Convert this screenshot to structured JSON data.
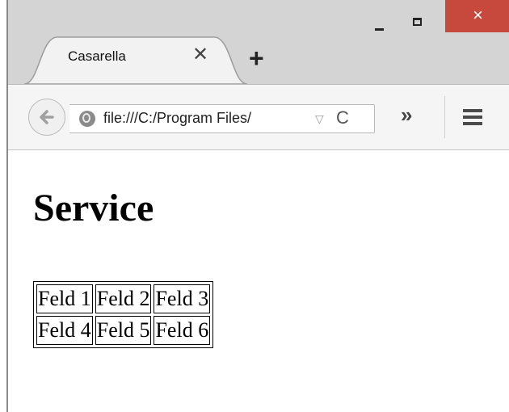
{
  "window": {
    "controls": {
      "close_glyph": "×"
    }
  },
  "tabs": [
    {
      "title": "Casarella",
      "close_glyph": "✕"
    }
  ],
  "new_tab_glyph": "+",
  "toolbar": {
    "back_glyph": "🡐",
    "url": "file:///C:/Program Files/",
    "dropdown_glyph": "▽",
    "reload_glyph": "C",
    "overflow_glyph": "»"
  },
  "page": {
    "heading": "Service",
    "table": [
      [
        "Feld 1",
        "Feld 2",
        "Feld 3"
      ],
      [
        "Feld 4",
        "Feld 5",
        "Feld 6"
      ]
    ]
  }
}
